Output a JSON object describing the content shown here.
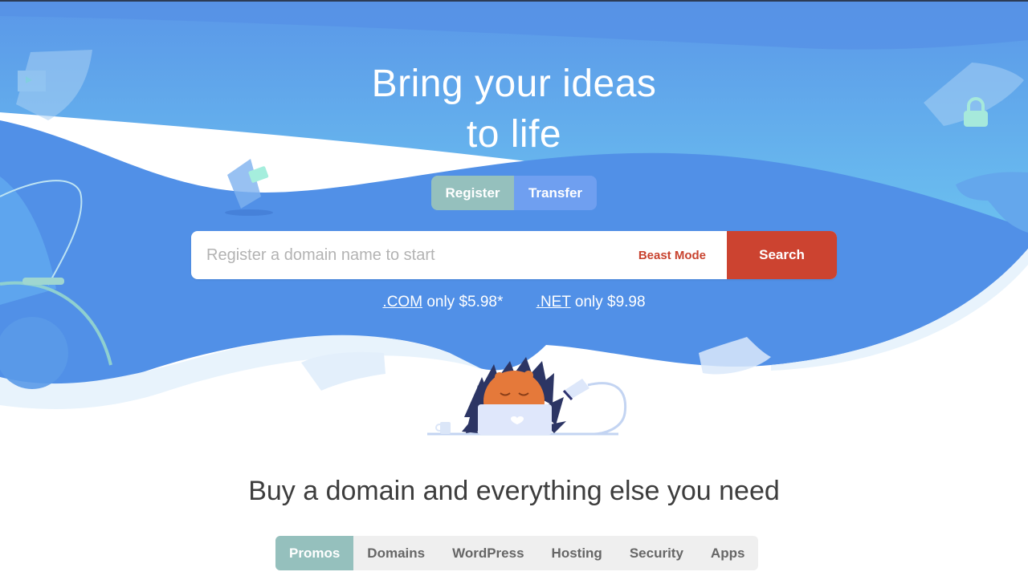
{
  "colors": {
    "hero_blue": "#5190e7",
    "hero_light_blue": "#67bdef",
    "accent_teal": "#95c0bd",
    "search_red": "#cc4330",
    "beast_mode_red": "#c8432f",
    "tabs_bg": "#efefef"
  },
  "hero": {
    "title_line1": "Bring your ideas",
    "title_line2": "to life",
    "mode_toggle": [
      {
        "label": "Register",
        "active": true
      },
      {
        "label": "Transfer",
        "active": false
      }
    ],
    "search": {
      "placeholder": "Register a domain name to start",
      "value": "",
      "beast_mode_label": "Beast Mode",
      "search_label": "Search"
    },
    "promos": [
      {
        "tld": ".COM",
        "text": "only $5.98*"
      },
      {
        "tld": ".NET",
        "text": "only $9.98"
      }
    ],
    "illustration": {
      "icons": [
        "hedgehog-mascot",
        "laptop-icon",
        "desk-lamp-icon",
        "coffee-mug-icon",
        "browser-window-icon",
        "envelope-icon",
        "padlock-icon",
        "desk-fan-icon"
      ]
    }
  },
  "section": {
    "title": "Buy a domain and everything else you need",
    "tabs": [
      {
        "label": "Promos",
        "active": true
      },
      {
        "label": "Domains",
        "active": false
      },
      {
        "label": "WordPress",
        "active": false
      },
      {
        "label": "Hosting",
        "active": false
      },
      {
        "label": "Security",
        "active": false
      },
      {
        "label": "Apps",
        "active": false
      }
    ]
  }
}
